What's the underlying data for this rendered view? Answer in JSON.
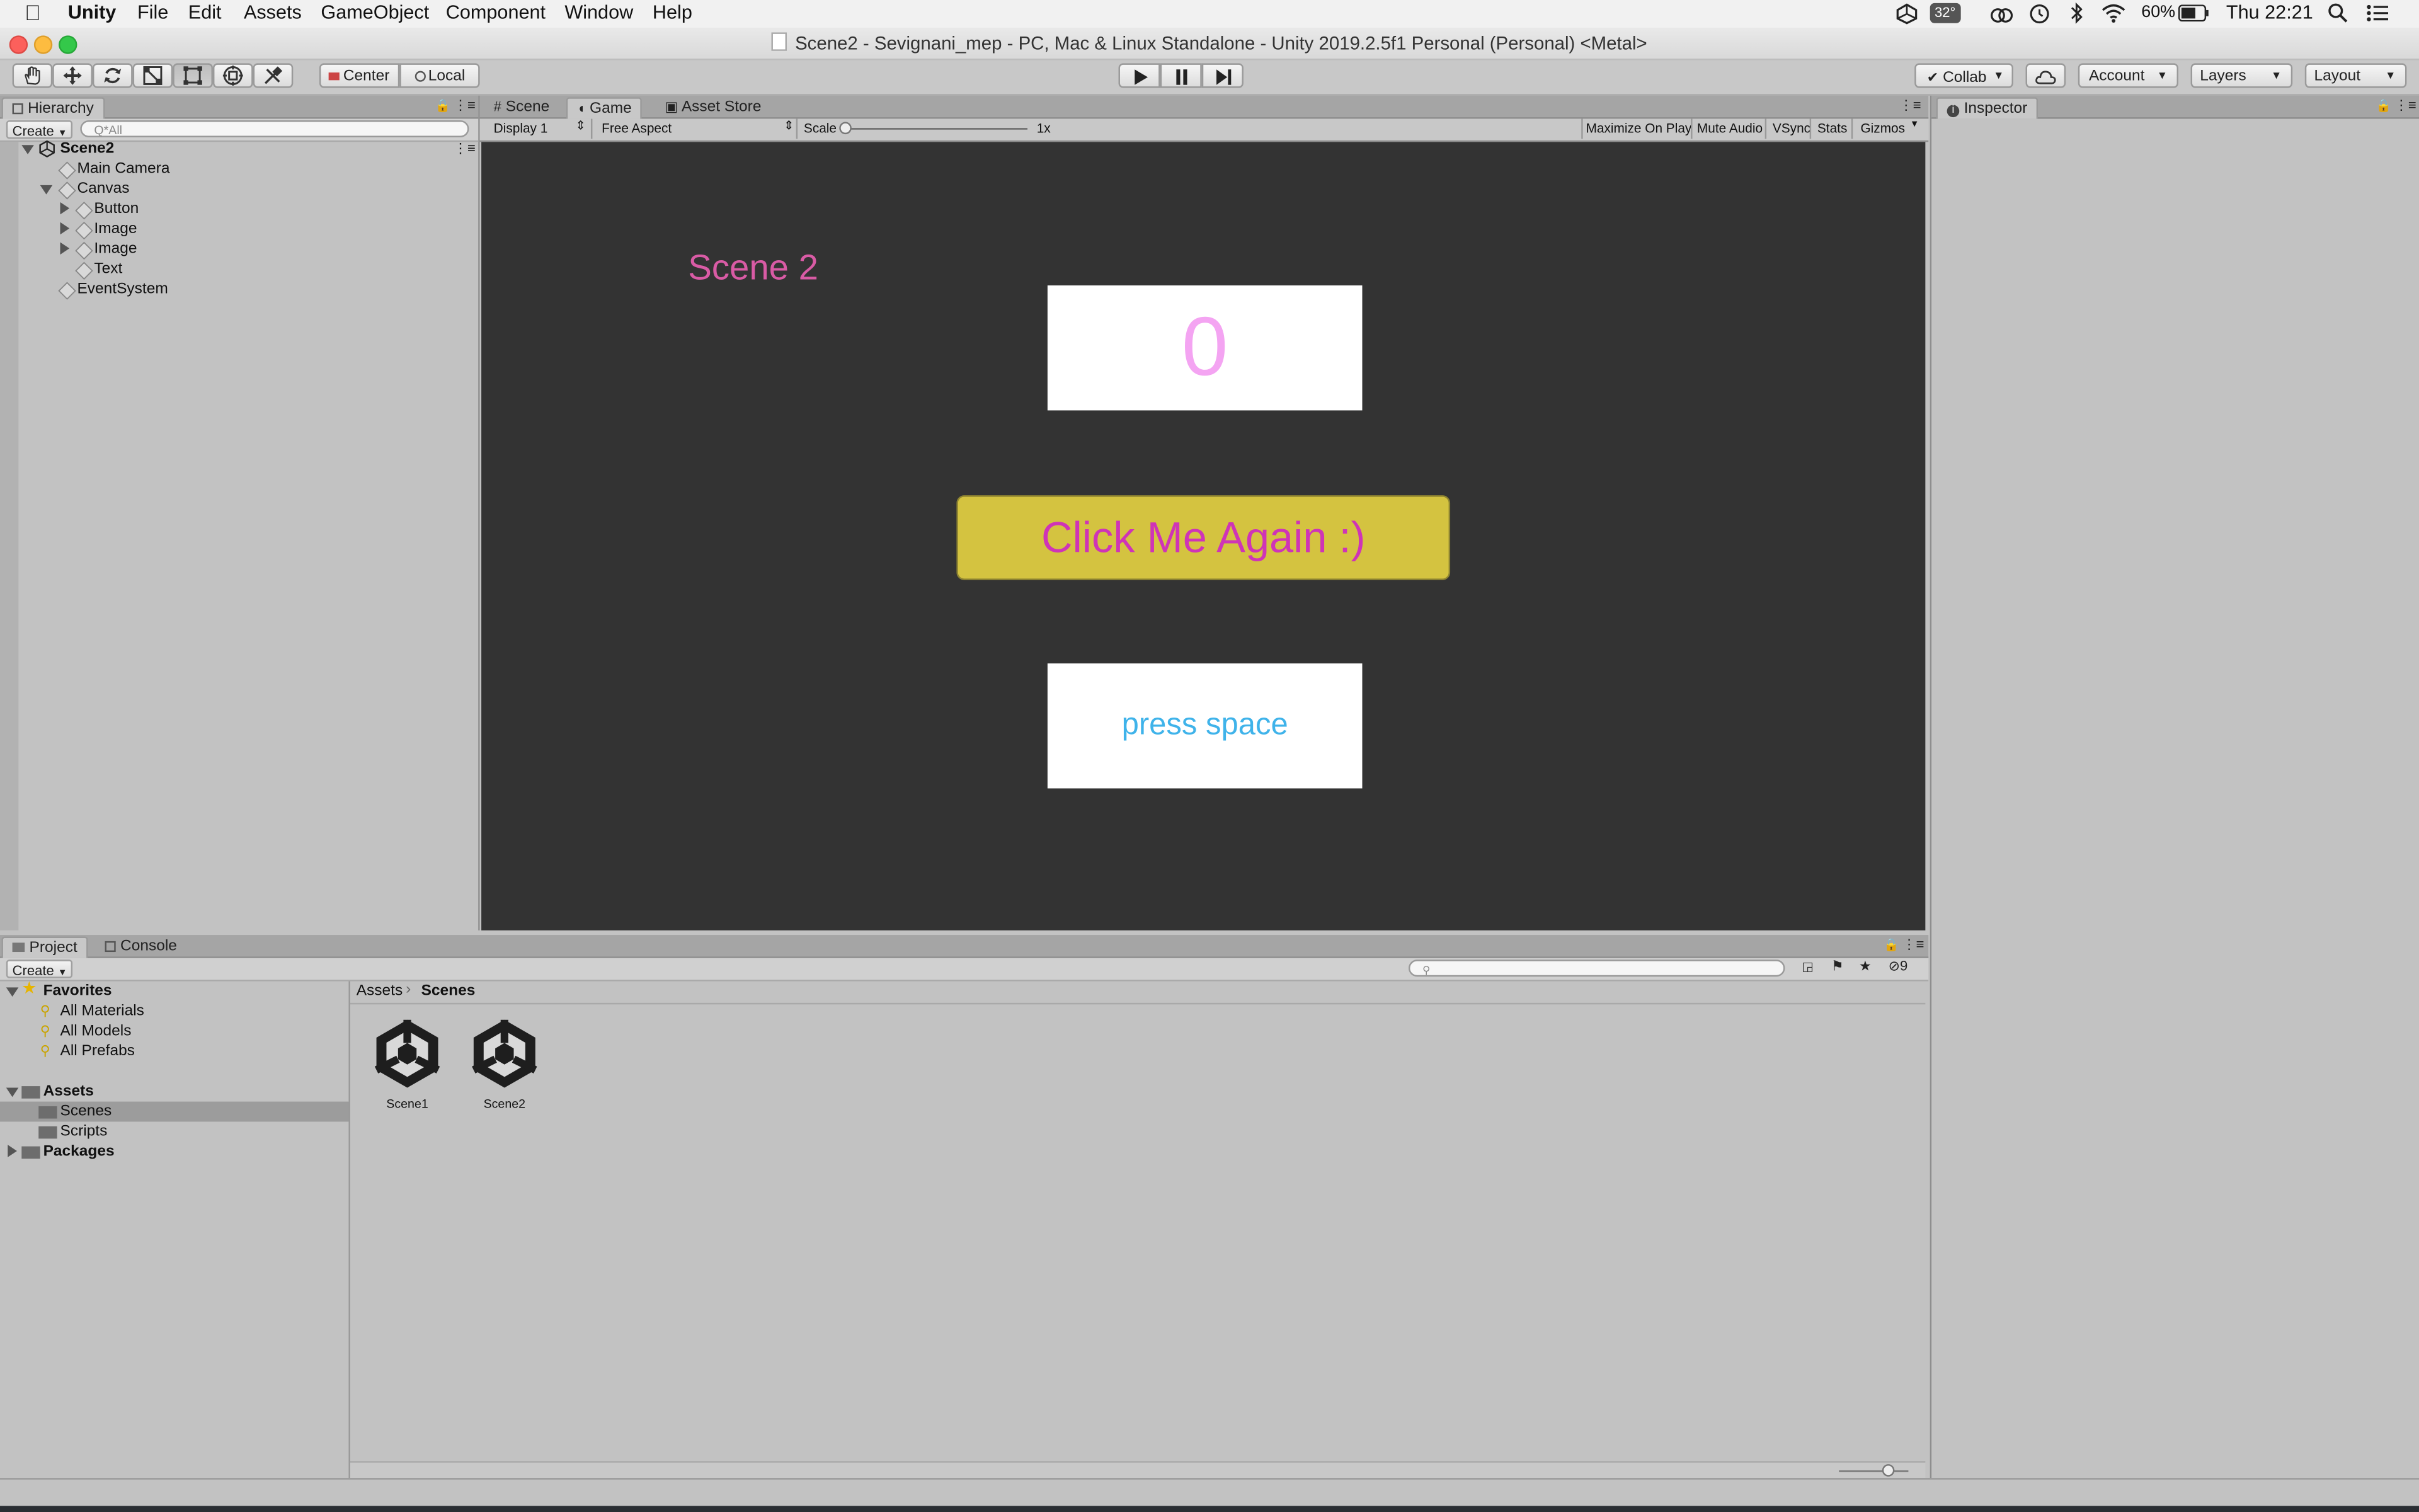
{
  "menubar": {
    "app": "Unity",
    "items": [
      "File",
      "Edit",
      "Assets",
      "GameObject",
      "Component",
      "Window",
      "Help"
    ],
    "status": {
      "temp": "32°",
      "battery": "60%",
      "clock": "Thu 22:21"
    }
  },
  "window": {
    "title": "Scene2 - Sevignani_mep - PC, Mac & Linux Standalone - Unity 2019.2.5f1 Personal (Personal) <Metal>"
  },
  "toolbar": {
    "pivot": "Center",
    "space": "Local",
    "collab": "Collab",
    "account": "Account",
    "layers": "Layers",
    "layout": "Layout"
  },
  "hierarchy": {
    "tab": "Hierarchy",
    "create": "Create",
    "search_placeholder": "Q*All",
    "scene": "Scene2",
    "items": {
      "main_camera": "Main Camera",
      "canvas": "Canvas",
      "button": "Button",
      "image1": "Image",
      "image2": "Image",
      "text": "Text",
      "event_system": "EventSystem"
    }
  },
  "center_tabs": {
    "scene": "Scene",
    "game": "Game",
    "asset_store": "Asset Store"
  },
  "game_bar": {
    "display": "Display 1",
    "aspect": "Free Aspect",
    "scale_label": "Scale",
    "scale_value": "1x",
    "scale_level": 0,
    "maximize": "Maximize On Play",
    "mute": "Mute Audio",
    "vsync": "VSync",
    "stats": "Stats",
    "gizmos": "Gizmos"
  },
  "game_view": {
    "scene_label": "Scene 2",
    "counter": "0",
    "button_label": "Click Me Again :)",
    "press_space": "press space",
    "colors": {
      "background": "#333333",
      "scene_label": "#d95ba5",
      "counter": "#f4a4f2",
      "button_bg": "#d4c340",
      "button_text": "#cf34b7",
      "press_space": "#3fb3ea"
    }
  },
  "inspector": {
    "tab": "Inspector"
  },
  "project": {
    "tabs": {
      "project": "Project",
      "console": "Console"
    },
    "create": "Create",
    "hidden_count": "9",
    "favorites": {
      "label": "Favorites",
      "items": [
        "All Materials",
        "All Models",
        "All Prefabs"
      ]
    },
    "assets": {
      "label": "Assets",
      "children": [
        "Scenes",
        "Scripts"
      ]
    },
    "packages": "Packages",
    "breadcrumb": {
      "root": "Assets",
      "current": "Scenes"
    },
    "files": [
      "Scene1",
      "Scene2"
    ],
    "zoom_level": 0.7
  }
}
